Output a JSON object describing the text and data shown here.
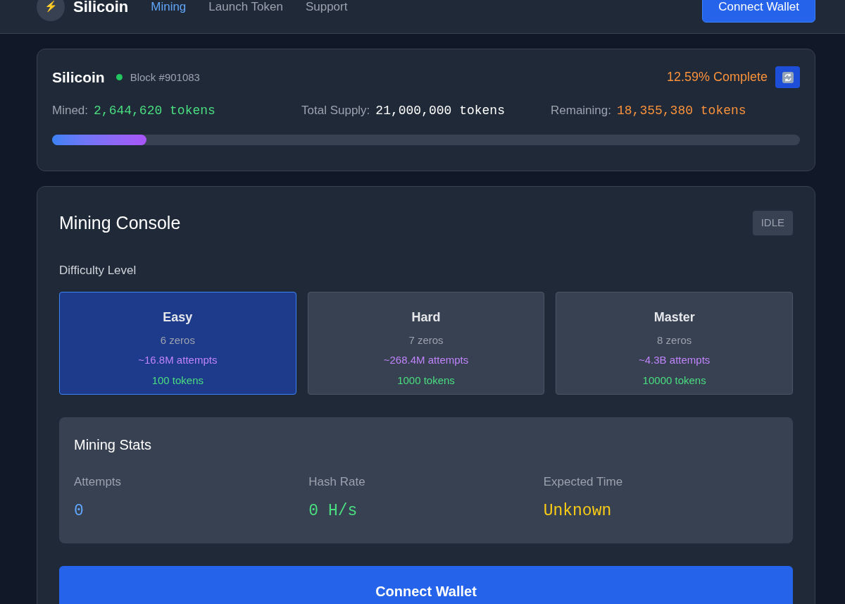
{
  "nav": {
    "brand": "Silicoin",
    "logo_glyph": "⚡",
    "links": [
      {
        "label": "Mining",
        "selected": true
      },
      {
        "label": "Launch Token",
        "selected": false
      },
      {
        "label": "Support",
        "selected": false
      }
    ],
    "button": "Connect Wallet"
  },
  "status": {
    "title": "Silicoin",
    "online": true,
    "block": "Block #901083",
    "complete": "12.59% Complete",
    "stats": [
      {
        "label": "Mined:",
        "value": "2,644,620 tokens",
        "color": "#4ade80"
      },
      {
        "label": "Total Supply:",
        "value": "21,000,000 tokens",
        "color": "#ffffff"
      },
      {
        "label": "Remaining:",
        "value": "18,355,380 tokens",
        "color": "#fb923c"
      }
    ],
    "progress": {
      "level": 0.1259
    }
  },
  "console": {
    "title": "Mining Console",
    "state": "IDLE",
    "difficulty_label": "Difficulty Level",
    "difficulties": [
      {
        "name": "Easy",
        "zeros": "6 zeros",
        "attempts": "~16.8M attempts",
        "reward": "100 tokens",
        "selected": true
      },
      {
        "name": "Hard",
        "zeros": "7 zeros",
        "attempts": "~268.4M attempts",
        "reward": "1000 tokens",
        "selected": false
      },
      {
        "name": "Master",
        "zeros": "8 zeros",
        "attempts": "~4.3B attempts",
        "reward": "10000 tokens",
        "selected": false
      }
    ],
    "stats_title": "Mining Stats",
    "stats": [
      {
        "label": "Attempts",
        "value": "0",
        "color": "#60a5fa"
      },
      {
        "label": "Hash Rate",
        "value": "0 H/s",
        "color": "#4ade80"
      },
      {
        "label": "Expected Time",
        "value": "Unknown",
        "color": "#facc15"
      }
    ],
    "button": "Connect Wallet"
  }
}
